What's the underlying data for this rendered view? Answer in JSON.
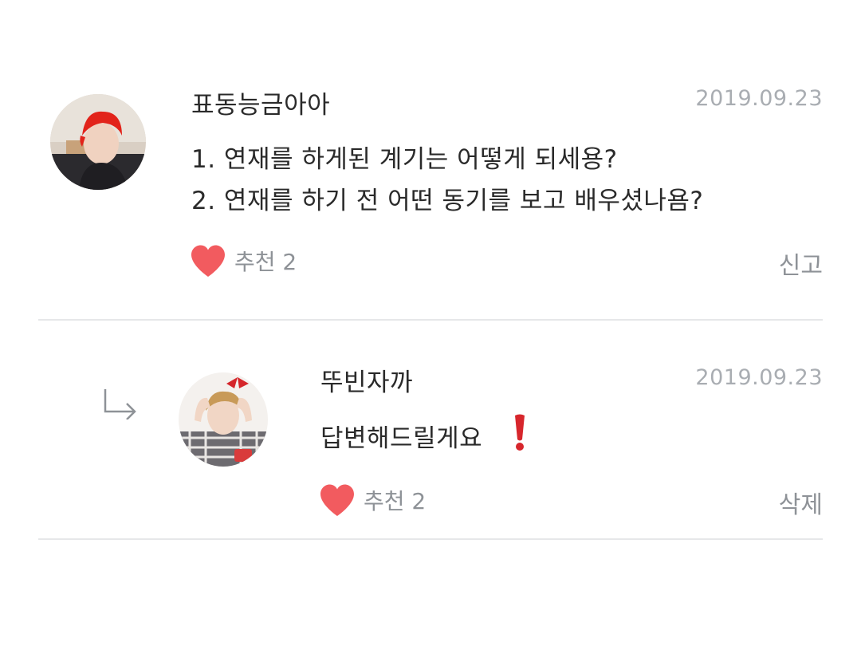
{
  "comments": [
    {
      "author": "표동능금아아",
      "date": "2019.09.23",
      "lines": [
        "1. 연재를 하게된 계기는 어떻게 되세용?",
        "2. 연재를 하기 전 어떤 동기를 보고 배우셨나욤?"
      ],
      "like_label": "추천 2",
      "action_label": "신고",
      "heart_icon": "heart-icon",
      "accent": "#f25b5f"
    }
  ],
  "reply": {
    "author": "뚜빈자까",
    "date": "2019.09.23",
    "text": "답변해드릴게요",
    "emoji_icon": "exclamation-icon",
    "like_label": "추천 2",
    "action_label": "삭제",
    "arrow_icon": "reply-arrow-icon"
  },
  "colors": {
    "heart": "#f25b5f",
    "muted_text": "#8e9297",
    "date_text": "#a9adb2",
    "divider": "#e6e7e9",
    "exclamation": "#d7262c"
  }
}
